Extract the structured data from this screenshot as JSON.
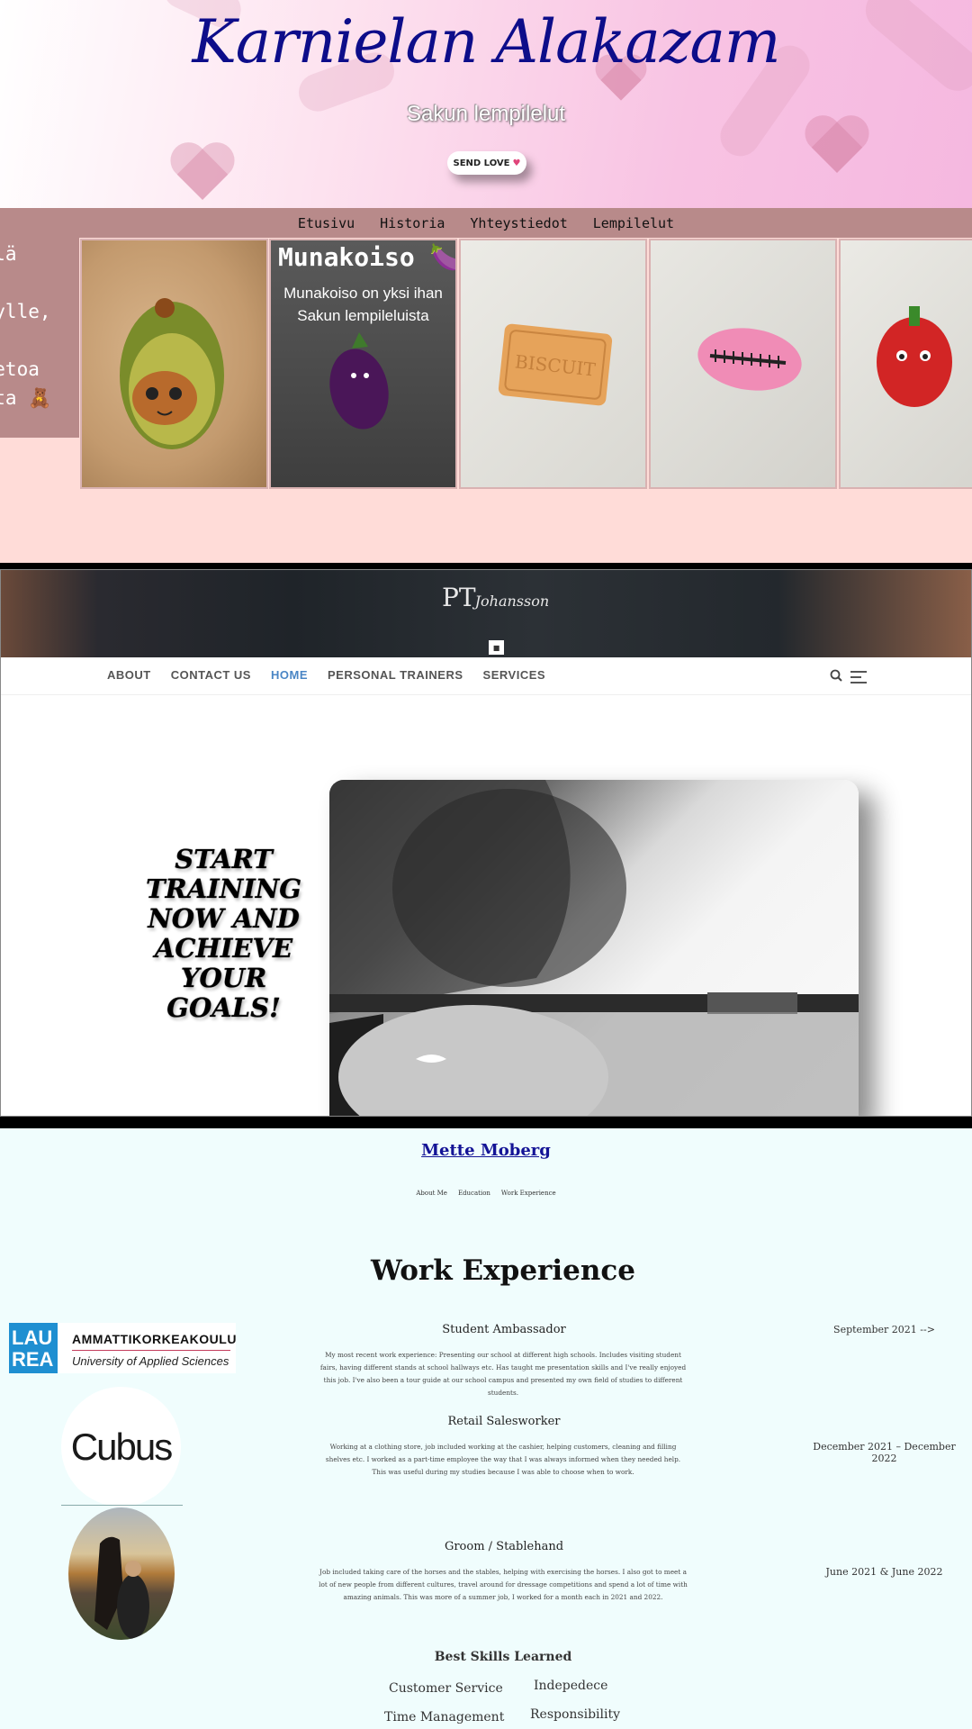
{
  "karniela": {
    "title": "Karnielan Alakazam",
    "subtitle": "Sakun lempilelut",
    "send_love_label": "SEND LOVE",
    "nav": [
      "Etusivu",
      "Historia",
      "Yhteystiedot",
      "Lempilelut"
    ],
    "side_text": "illä\nen\nn ylle,\nit\ntietoa\nista 🧸",
    "cards": [
      {
        "name": "avocado toy"
      },
      {
        "name": "eggplant toy",
        "title": "Munakoiso 🍆",
        "text": "Munakoiso on yksi ihan Sakun lempileluista"
      },
      {
        "name": "biscuit toy",
        "stamp": "BISCUIT"
      },
      {
        "name": "rugby ball toy"
      },
      {
        "name": "red pepper toy"
      }
    ],
    "colors": {
      "nav": "#b88a8a",
      "background": "#ffdcd8",
      "title": "#0d0d8a"
    }
  },
  "pt": {
    "logo_initials": "PT",
    "logo_name": "Johansson",
    "nav": [
      {
        "label": "ABOUT",
        "active": false
      },
      {
        "label": "CONTACT US",
        "active": false
      },
      {
        "label": "HOME",
        "active": true
      },
      {
        "label": "PERSONAL TRAINERS",
        "active": false
      },
      {
        "label": "SERVICES",
        "active": false
      }
    ],
    "tagline": "START TRAINING NOW AND ACHIEVE YOUR GOALS!",
    "icons": [
      "search-icon",
      "hamburger-menu-icon"
    ],
    "colors": {
      "active_nav": "#4a86c5"
    }
  },
  "mette": {
    "name": "Mette Moberg",
    "nav": [
      "About Me",
      "Education",
      "Work Experience"
    ],
    "heading": "Work Experience",
    "laurea_logo": {
      "mark": "LAU REA",
      "name": "AMMATTIKORKEAKOULU",
      "sub": "University of Applied Sciences"
    },
    "cubus_logo": "Cubus",
    "jobs": [
      {
        "title": "Student Ambassador",
        "date": "September 2021 -->",
        "desc": "My most recent work experience: Presenting our school at different high schools. Includes visiting student fairs, having different stands at school hallways etc. Has taught me presentation skills and I've really enjoyed this job. I've also been a tour guide at our school campus and presented my own field of studies to different students."
      },
      {
        "title": "Retail Salesworker",
        "date": "December 2021 – December 2022",
        "desc": "Working at a clothing store, job included working at the cashier, helping customers, cleaning and filling shelves etc. I worked as a part-time employee the way that I was always informed when they needed help. This was useful during my studies because I was able to choose when to work."
      },
      {
        "title": "Groom / Stablehand",
        "date": "June 2021 & June 2022",
        "desc": "Job included taking care of the horses and the stables, helping with exercising the horses. I also got to meet a lot of new people from different cultures, travel around for dressage competitions and spend a lot of time with amazing animals. This was more of a summer job, I worked for a month each in 2021 and 2022."
      }
    ],
    "skills_heading": "Best Skills Learned",
    "skills": [
      "Customer Service",
      "Indepedece",
      "Time Management",
      "Responsibility"
    ]
  }
}
